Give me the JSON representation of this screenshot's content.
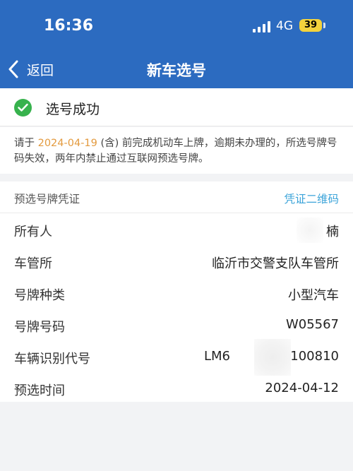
{
  "status_bar": {
    "time": "16:36",
    "network": "4G",
    "battery": "39"
  },
  "navbar": {
    "back_label": "返回",
    "title": "新车选号"
  },
  "result": {
    "text": "选号成功"
  },
  "notice": {
    "prefix": "请于 ",
    "date": "2024-04-19",
    "suffix": " (含) 前完成机动车上牌，逾期未办理的，所选号牌号码失效，两年内禁止通过互联网预选号牌。"
  },
  "voucher": {
    "header_label": "预选号牌凭证",
    "qr_link": "凭证二维码",
    "rows": [
      {
        "key": "所有人",
        "value": "楠"
      },
      {
        "key": "车管所",
        "value": "临沂市交警支队车管所"
      },
      {
        "key": "号牌种类",
        "value": "小型汽车"
      },
      {
        "key": "号牌号码",
        "value": "W05567"
      },
      {
        "key": "车辆识别代号",
        "value_start": "LM6",
        "value_end": "100810"
      },
      {
        "key": "预选时间",
        "value": "2024-04-12"
      }
    ]
  },
  "colors": {
    "brand": "#2c6bc0",
    "success": "#37b24d",
    "date_highlight": "#e39a3e",
    "link": "#3aa3d9"
  }
}
